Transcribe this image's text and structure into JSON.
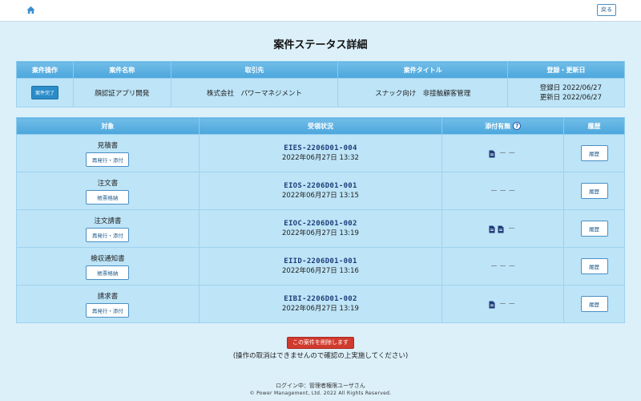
{
  "header": {
    "back_label": "戻る"
  },
  "page": {
    "title": "案件ステータス詳細"
  },
  "case_table": {
    "headers": [
      "案件操作",
      "案件名称",
      "取引先",
      "案件タイトル",
      "登録・更新日"
    ],
    "complete_label": "案件完了",
    "name": "顔認証アプリ開発",
    "client": "株式会社　パワーマネジメント",
    "title": "スナック向け　非接触顧客管理",
    "registered": "登録日 2022/06/27",
    "updated": "更新日 2022/06/27"
  },
  "docs_table": {
    "headers": {
      "target": "対象",
      "status": "受領状況",
      "attachment": "添付有無",
      "history": "履歴"
    },
    "history_label": "履歴",
    "rows": [
      {
        "target": "見積書",
        "action": "再発行・添付",
        "doc_no": "EIES-2206D01-004",
        "date": "2022年06月27日 13:32",
        "dash": "ー ー"
      },
      {
        "target": "注文書",
        "action": "帳票格納",
        "doc_no": "EIOS-2206D01-001",
        "date": "2022年06月27日 13:15",
        "dash": "ー ー ー"
      },
      {
        "target": "注文請書",
        "action": "再発行・添付",
        "doc_no": "EIOC-2206D01-002",
        "date": "2022年06月27日 13:19",
        "dash": "ー"
      },
      {
        "target": "検収通知書",
        "action": "帳票格納",
        "doc_no": "EIID-2206D01-001",
        "date": "2022年06月27日 13:16",
        "dash": "ー ー ー"
      },
      {
        "target": "請求書",
        "action": "再発行・添付",
        "doc_no": "EIBI-2206D01-002",
        "date": "2022年06月27日 13:19",
        "dash": "ー ー"
      }
    ]
  },
  "delete": {
    "button_label": "この案件を削除します",
    "note": "(操作の取消はできませんので確認の上実施してください)"
  },
  "footer": {
    "login": "ログイン中：管理者権限ユーザさん",
    "copyright": "© Power Management, Ltd. 2022 All Rights Reserved."
  },
  "icons": {
    "home": "home-icon",
    "file": "file-icon",
    "help": "help-icon"
  },
  "colors": {
    "header_blue": "#4ba6dc",
    "delete_red": "#d13a2e",
    "background": "#dcf0fa"
  }
}
